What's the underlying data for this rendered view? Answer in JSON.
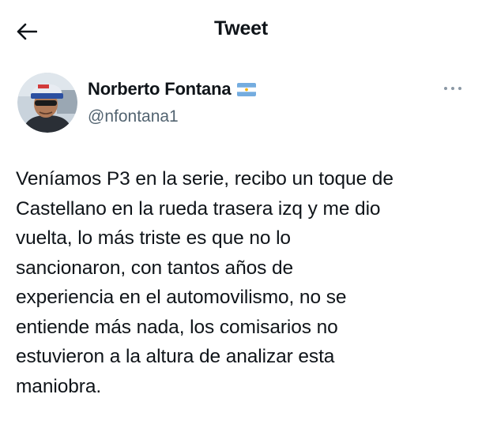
{
  "header": {
    "title": "Tweet",
    "back_icon": "arrow-left-icon"
  },
  "author": {
    "display_name": "Norberto Fontana",
    "handle": "@nfontana1",
    "flag_icon": "argentina-flag-icon",
    "more_icon": "more-dots-icon"
  },
  "tweet": {
    "text": "Veníamos P3 en la serie, recibo un toque de\nCastellano en la rueda trasera izq y me dio\nvuelta, lo más triste es que no lo\nsancionaron, con tantos años de\nexperiencia en el automovilismo, no se\nentiende más nada, los comisarios no\nestuvieron a la altura de analizar esta\nmaniobra."
  },
  "colors": {
    "text": "#0f1419",
    "secondary_text": "#536471",
    "flag_blue": "#74acdf",
    "flag_white": "#ffffff",
    "flag_sun": "#f6b40e"
  }
}
